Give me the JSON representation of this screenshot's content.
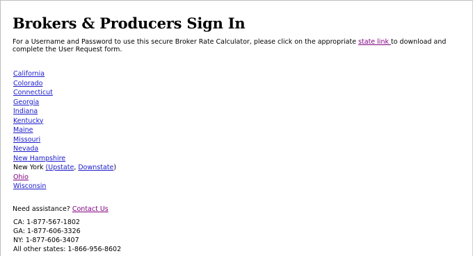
{
  "title": "Brokers & Producers Sign In",
  "intro": {
    "before": "For a Username and Password to use this secure Broker Rate Calculator, please click on the appropriate ",
    "link": "state link ",
    "after": "to download and complete the User Request form."
  },
  "states": [
    {
      "label": "California",
      "visited": false
    },
    {
      "label": "Colorado",
      "visited": false
    },
    {
      "label": "Connecticut",
      "visited": false
    },
    {
      "label": "Georgia",
      "visited": false
    },
    {
      "label": "Indiana",
      "visited": false
    },
    {
      "label": "Kentucky",
      "visited": false
    },
    {
      "label": "Maine",
      "visited": false
    },
    {
      "label": "Missouri",
      "visited": false
    },
    {
      "label": "Nevada",
      "visited": false
    },
    {
      "label": "New Hampshire",
      "visited": false
    }
  ],
  "new_york": {
    "label": "New York ",
    "open": "(",
    "upstate": "Upstate",
    "sep": ", ",
    "downstate": "Downstate",
    "close": ")"
  },
  "states_after": [
    {
      "label": "Ohio",
      "visited": true
    },
    {
      "label": "Wisconsin",
      "visited": false
    }
  ],
  "assistance": {
    "text": "Need assistance? ",
    "link": "Contact Us"
  },
  "phones": [
    "CA: 1-877-567-1802",
    "GA: 1-877-606-3326",
    "NY: 1-877-606-3407",
    "All other states: 1-866-956-8602"
  ],
  "colors": {
    "link": "#1a1acc",
    "visited": "#800080"
  }
}
